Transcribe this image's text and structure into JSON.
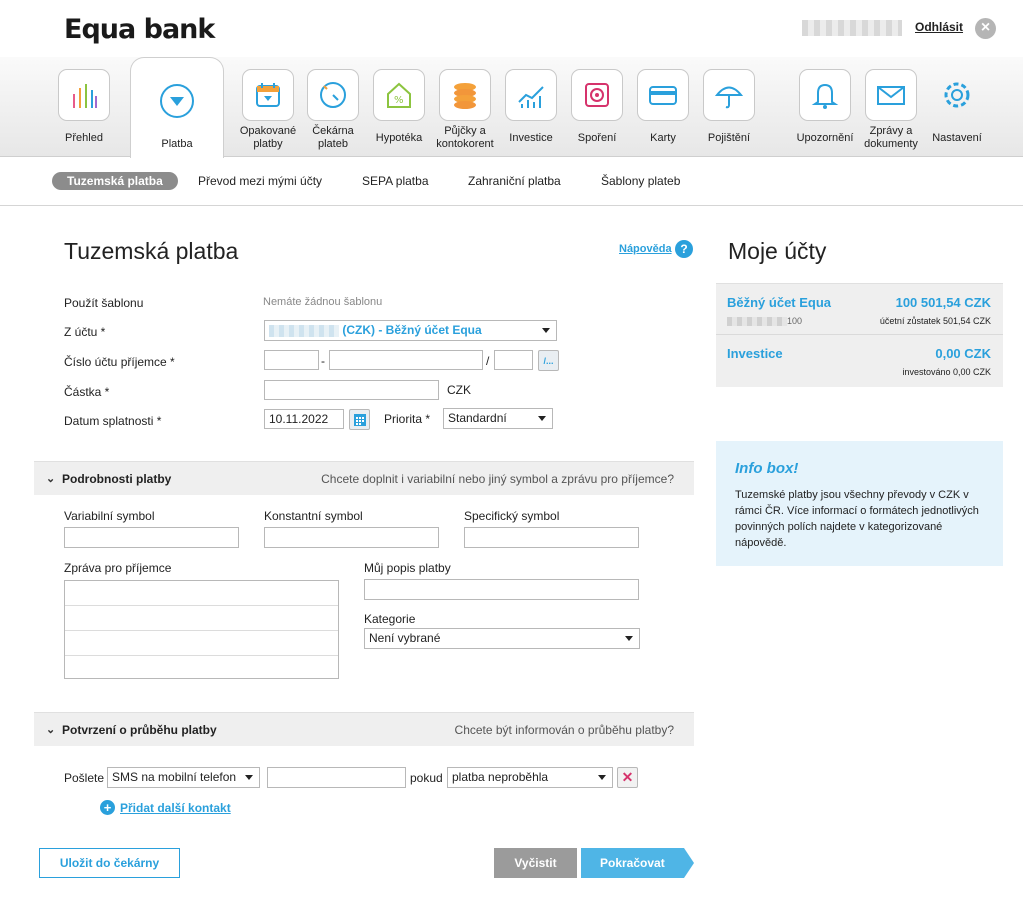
{
  "header": {
    "logo": "Equa bank",
    "logout": "Odhlásit"
  },
  "nav": [
    {
      "label": "Přehled",
      "icon": "chart-bars-icon"
    },
    {
      "label": "Platba",
      "icon": "payment-down-icon"
    },
    {
      "label": "Opakované platby",
      "icon": "calendar-icon"
    },
    {
      "label": "Čekárna plateb",
      "icon": "clock-icon"
    },
    {
      "label": "Hypotéka",
      "icon": "house-percent-icon"
    },
    {
      "label": "Půjčky a kontokorent",
      "icon": "coins-icon"
    },
    {
      "label": "Investice",
      "icon": "line-chart-icon"
    },
    {
      "label": "Spoření",
      "icon": "safe-icon"
    },
    {
      "label": "Karty",
      "icon": "card-icon"
    },
    {
      "label": "Pojištění",
      "icon": "umbrella-icon"
    },
    {
      "label": "Upozornění",
      "icon": "bell-icon"
    },
    {
      "label": "Zprávy a dokumenty",
      "icon": "envelope-icon"
    },
    {
      "label": "Nastavení",
      "icon": "gear-icon"
    }
  ],
  "subnav": [
    "Tuzemská platba",
    "Převod mezi mými účty",
    "SEPA platba",
    "Zahraniční platba",
    "Šablony plateb"
  ],
  "form": {
    "title": "Tuzemská platba",
    "help": "Nápověda",
    "template_label": "Použít šablonu",
    "template_value": "Nemáte žádnou šablonu",
    "from_label": "Z účtu *",
    "from_value": "(CZK) - Běžný účet Equa",
    "recipient_label": "Číslo účtu příjemce *",
    "recipient_dash": "-",
    "recipient_slash": "/",
    "bank_button": "/...",
    "amount_label": "Částka *",
    "currency": "CZK",
    "due_label": "Datum splatnosti *",
    "due_value": "10.11.2022",
    "priority_label": "Priorita *",
    "priority_value": "Standardní"
  },
  "details": {
    "title": "Podrobnosti platby",
    "question": "Chcete doplnit i variabilní nebo jiný symbol a zprávu pro příjemce?",
    "variable": "Variabilní symbol",
    "constant": "Konstantní symbol",
    "specific": "Specifický symbol",
    "message": "Zpráva pro příjemce",
    "my_desc": "Můj popis platby",
    "category": "Kategorie",
    "category_value": "Není vybrané"
  },
  "confirmation": {
    "title": "Potvrzení o průběhu platby",
    "question": "Chcete být informován o průběhu platby?",
    "send": "Pošlete",
    "method": "SMS na mobilní telefon",
    "if": "pokud",
    "condition": "platba neproběhla",
    "add_contact": "Přidat další kontakt"
  },
  "buttons": {
    "save": "Uložit do čekárny",
    "clear": "Vyčistit",
    "continue": "Pokračovat"
  },
  "sidebar": {
    "title": "Moje účty",
    "accounts": [
      {
        "name": "Běžný účet Equa",
        "amount": "100 501,54 CZK",
        "num_suffix": "100",
        "sub": "účetní zůstatek 501,54 CZK"
      },
      {
        "name": "Investice",
        "amount": "0,00 CZK",
        "sub": "investováno 0,00 CZK"
      }
    ],
    "infobox_title": "Info box!",
    "infobox_text": "Tuzemské platby jsou všechny převody v CZK v rámci ČR. Více informací o formátech jednotlivých povinných polích najdete v kategorizované nápovědě."
  },
  "colors": {
    "accent": "#2aa0dc",
    "continue": "#4fb5e6",
    "clear": "#9b9b9b"
  }
}
